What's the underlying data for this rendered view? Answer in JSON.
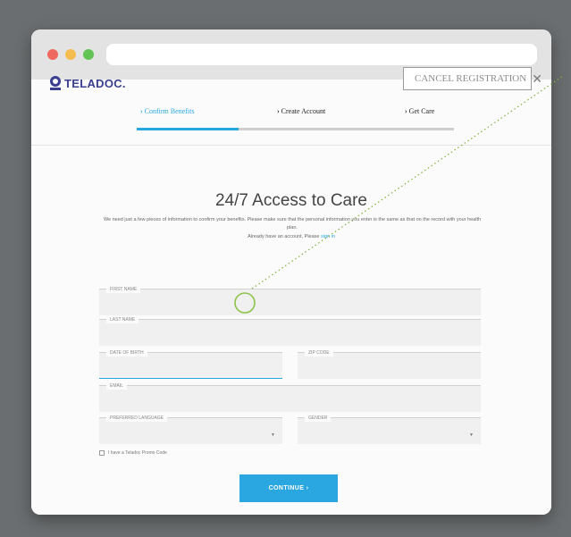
{
  "brand": {
    "name": "TELADOC.",
    "accent": "#25a8e0",
    "logo_color": "#3a3f8f",
    "annotation_color": "#8bc34a"
  },
  "header": {
    "cancel_label": "CANCEL REGISTRATION",
    "cancel_icon": "close-icon"
  },
  "steps": [
    {
      "label": "Confirm Benefits",
      "active": true
    },
    {
      "label": "Create Account",
      "active": false
    },
    {
      "label": "Get Care",
      "active": false
    }
  ],
  "progress_fraction": 0.32,
  "main": {
    "title": "24/7 Access to Care",
    "intro": "We need just a few pieces of information to confirm your benefits. Please make sure that the personal information you enter is the same as that on the record with your health plan.",
    "already_text": "Already have an account, Please",
    "sign_in": "sign in"
  },
  "form": {
    "first_name": "FIRST NAME",
    "last_name": "LAST NAME",
    "dob": "DATE OF BIRTH",
    "zip": "ZIP CODE",
    "email": "EMAIL",
    "language": "PREFERRED LANGUAGE",
    "gender": "GENDER",
    "promo": "I have a Teladoc Promo Code",
    "continue": "CONTINUE ›",
    "dropdown_icon": "chevron-down-icon"
  }
}
